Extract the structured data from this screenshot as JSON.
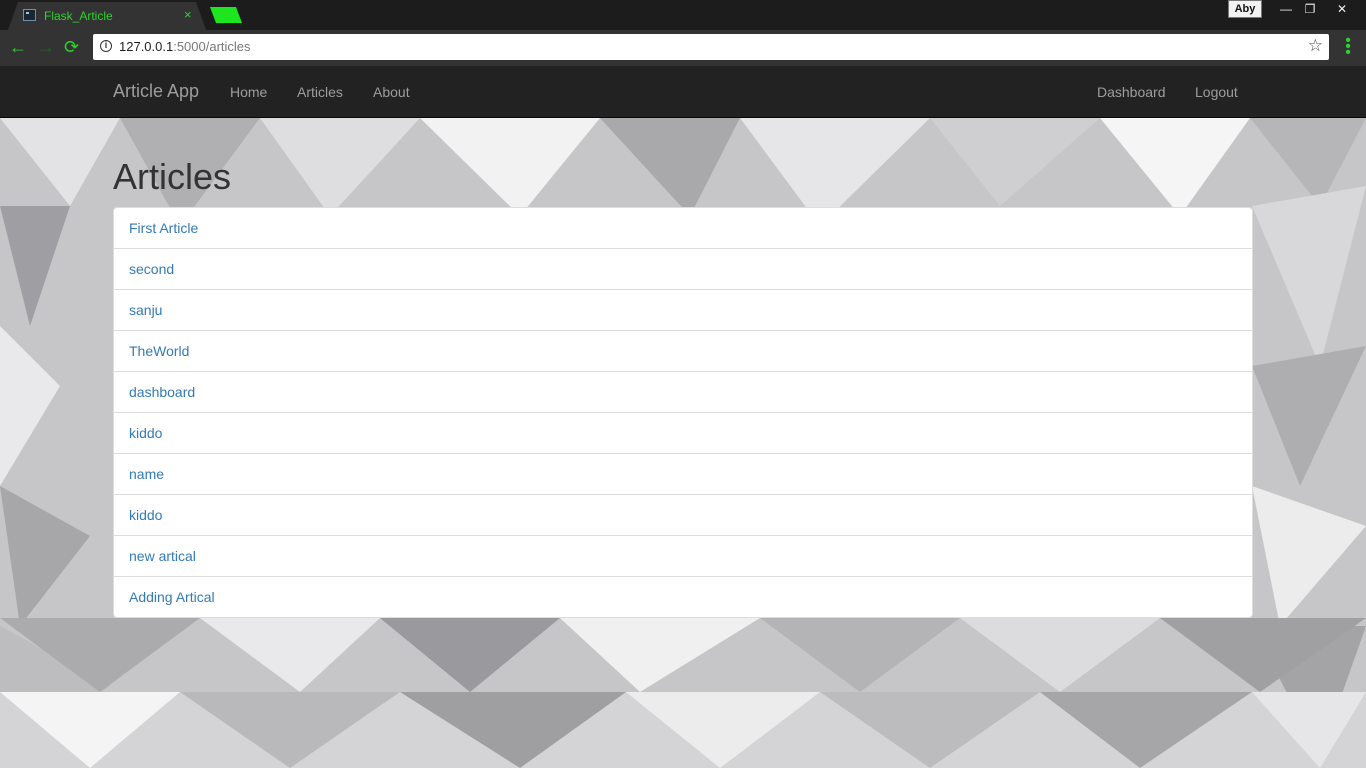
{
  "browser": {
    "tab_title": "Flask_Article",
    "tab_close": "×",
    "profile": "Aby",
    "url_host": "127.0.0.1",
    "url_rest": ":5000/articles",
    "back_glyph": "←",
    "forward_glyph": "→",
    "reload_glyph": "⟳",
    "info_glyph": "i",
    "star_glyph": "☆",
    "menu_glyph": "⋮",
    "minimize_glyph": "—",
    "restore_glyph": "❐",
    "close_glyph": "✕",
    "accent_color": "#2ed22e"
  },
  "navbar": {
    "brand": "Article App",
    "left_links": [
      "Home",
      "Articles",
      "About"
    ],
    "right_links": [
      "Dashboard",
      "Logout"
    ]
  },
  "page": {
    "title": "Articles",
    "link_color": "#337ab7"
  },
  "articles": [
    "First Article",
    "second",
    "sanju",
    "TheWorld",
    "dashboard",
    "kiddo",
    "name",
    "kiddo",
    "new artical",
    "Adding Artical"
  ]
}
